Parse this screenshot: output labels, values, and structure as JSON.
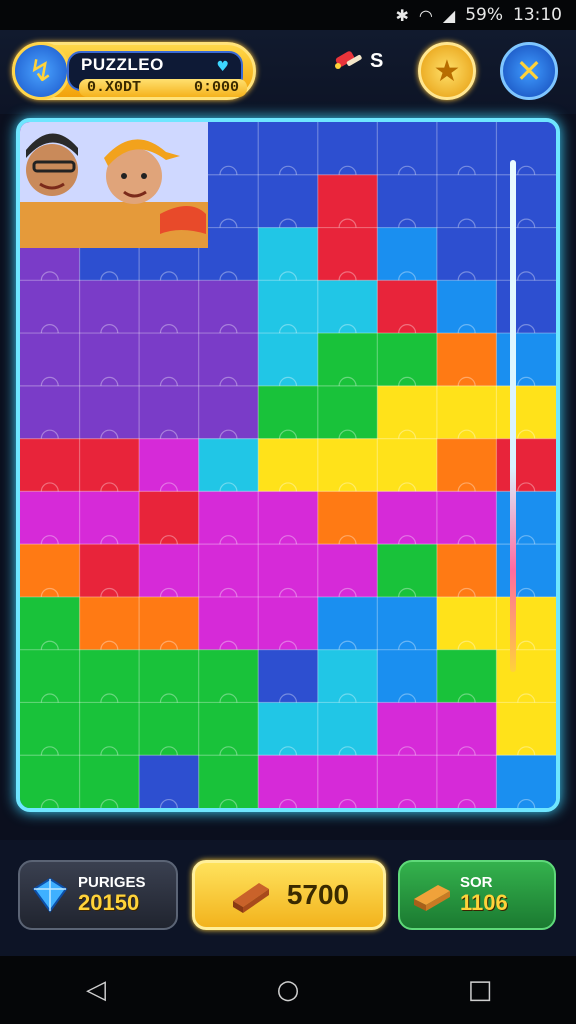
{
  "status_bar": {
    "battery": "59%",
    "time": "13:10",
    "icons": [
      "bluetooth-icon",
      "wifi-icon",
      "signal-icon"
    ]
  },
  "hud": {
    "profile_name": "PUZZLEO",
    "stat_left": "0.X0DT",
    "stat_right": "0:000",
    "tool_count": "S",
    "colors": {
      "gold": "#f2a20b",
      "blue": "#1955c9",
      "cyan": "#6fe6ff"
    }
  },
  "board": {
    "columns": 9,
    "rows": 13,
    "palette": [
      "#7a3cc8",
      "#2d4fd0",
      "#21c6e6",
      "#19c23a",
      "#ffe21a",
      "#ff7a14",
      "#e8243a",
      "#d62ad8",
      "#1a8ff0"
    ]
  },
  "resources": {
    "gems_label": "PURIGES",
    "gems_value": "20150",
    "gold_value": "5700",
    "sor_label": "SOR",
    "sor_value": "1106"
  },
  "nav": {
    "icons": [
      "back-icon",
      "home-icon",
      "recents-icon"
    ]
  }
}
